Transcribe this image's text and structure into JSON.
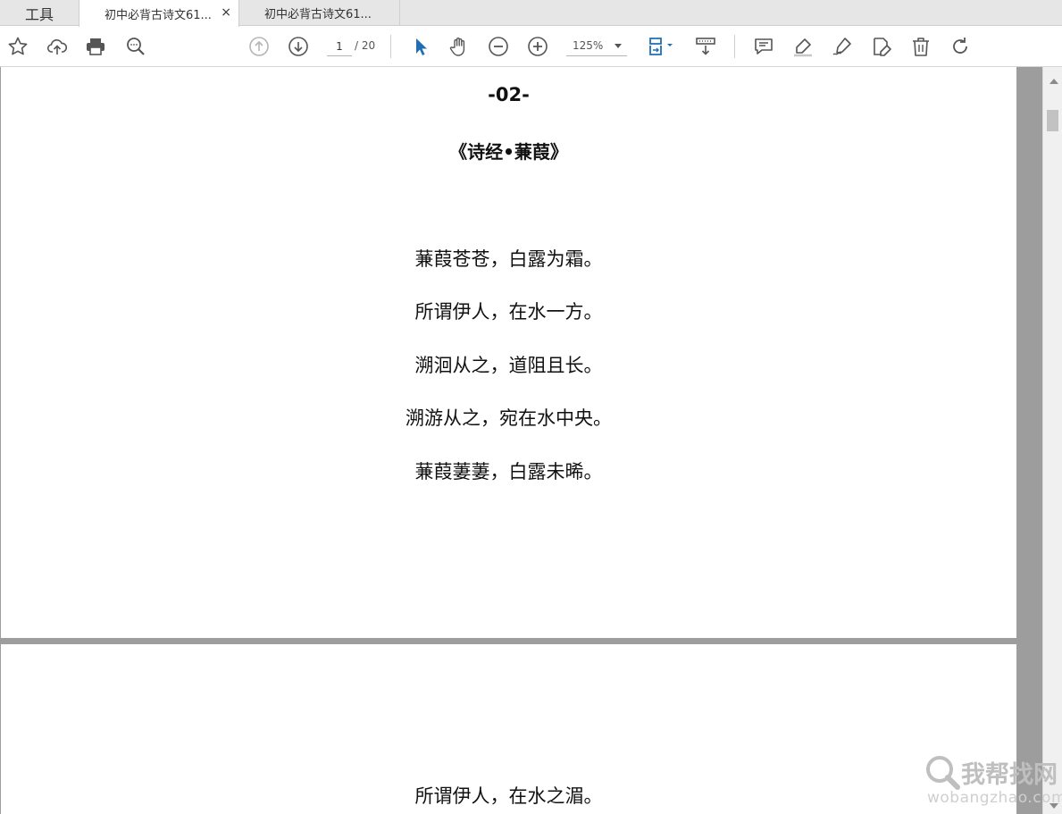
{
  "tabs": {
    "tools_label": "工具",
    "active_tab": "初中必背古诗文61...",
    "active_close": "×",
    "second_tab": "初中必背古诗文61..."
  },
  "toolbar": {
    "current_page": "1",
    "total_pages": "/ 20",
    "zoom": "125%",
    "accent_color": "#1f6fb5"
  },
  "document": {
    "page_number": "-02-",
    "poem_title": "《诗经•蒹葭》",
    "verses": [
      "蒹葭苍苍，白露为霜。",
      "所谓伊人，在水一方。",
      "溯洄从之，道阻且长。",
      "溯游从之，宛在水中央。",
      "蒹葭萋萋，白露未晞。"
    ],
    "next_page_verse": "所谓伊人，在水之湄。"
  },
  "watermark": {
    "cn": "我帮找网",
    "en": "wobangzhao.com"
  }
}
